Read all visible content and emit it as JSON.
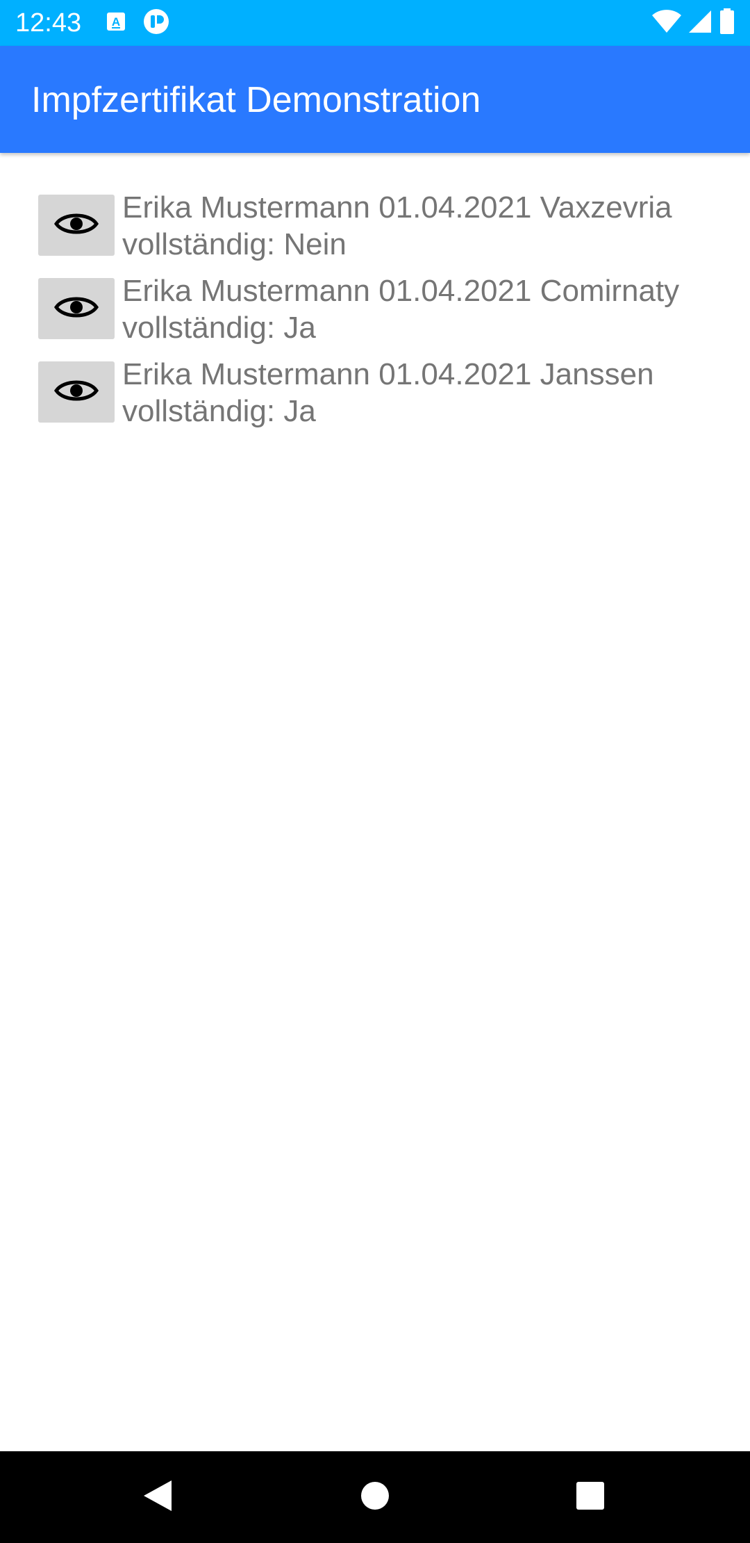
{
  "status_bar": {
    "time": "12:43",
    "icons": [
      "translate-app-icon",
      "app-notification-icon",
      "wifi-icon",
      "cell-signal-icon",
      "battery-icon"
    ]
  },
  "app_bar": {
    "title": "Impfzertifikat Demonstration"
  },
  "certificates": [
    {
      "line1": "Erika Mustermann 01.04.2021 Vaxzevria",
      "line2": "vollständig: Nein"
    },
    {
      "line1": "Erika Mustermann 01.04.2021 Comirnaty",
      "line2": "vollständig: Ja"
    },
    {
      "line1": "Erika Mustermann 01.04.2021 Janssen",
      "line2": "vollständig: Ja"
    }
  ],
  "nav_bar": {
    "buttons": [
      "back-icon",
      "home-icon",
      "recents-icon"
    ]
  },
  "colors": {
    "status_bar": "#00b0ff",
    "app_bar": "#2979ff",
    "list_text": "#757575",
    "button_bg": "#d6d6d6"
  }
}
